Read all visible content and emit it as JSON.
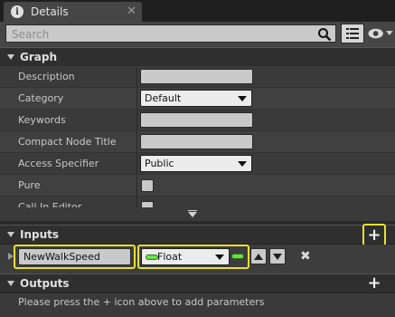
{
  "tab": {
    "title": "Details",
    "icon": "info-icon",
    "close": "✕"
  },
  "search": {
    "placeholder": "Search"
  },
  "toolbar": {
    "view_options_icon": "view-options-icon",
    "eye_icon": "eye-icon"
  },
  "graph": {
    "title": "Graph",
    "rows": [
      {
        "label": "Description",
        "kind": "text",
        "value": ""
      },
      {
        "label": "Category",
        "kind": "combo",
        "value": "Default"
      },
      {
        "label": "Keywords",
        "kind": "text",
        "value": ""
      },
      {
        "label": "Compact Node Title",
        "kind": "text",
        "value": ""
      },
      {
        "label": "Access Specifier",
        "kind": "combo",
        "value": "Public"
      },
      {
        "label": "Pure",
        "kind": "check",
        "checked": false
      },
      {
        "label": "Call In Editor",
        "kind": "check",
        "checked": false
      }
    ]
  },
  "inputs": {
    "title": "Inputs",
    "add_label": "+",
    "params": [
      {
        "name": "NewWalkSpeed",
        "type": "Float",
        "type_color": "#6be046"
      }
    ],
    "delete_label": "✖"
  },
  "outputs": {
    "title": "Outputs",
    "add_label": "+",
    "empty_message": "Please press the + icon above to add parameters"
  },
  "colors": {
    "highlight": "#e8e030",
    "float_pin": "#6be046",
    "panel": "#3d3d3d"
  }
}
